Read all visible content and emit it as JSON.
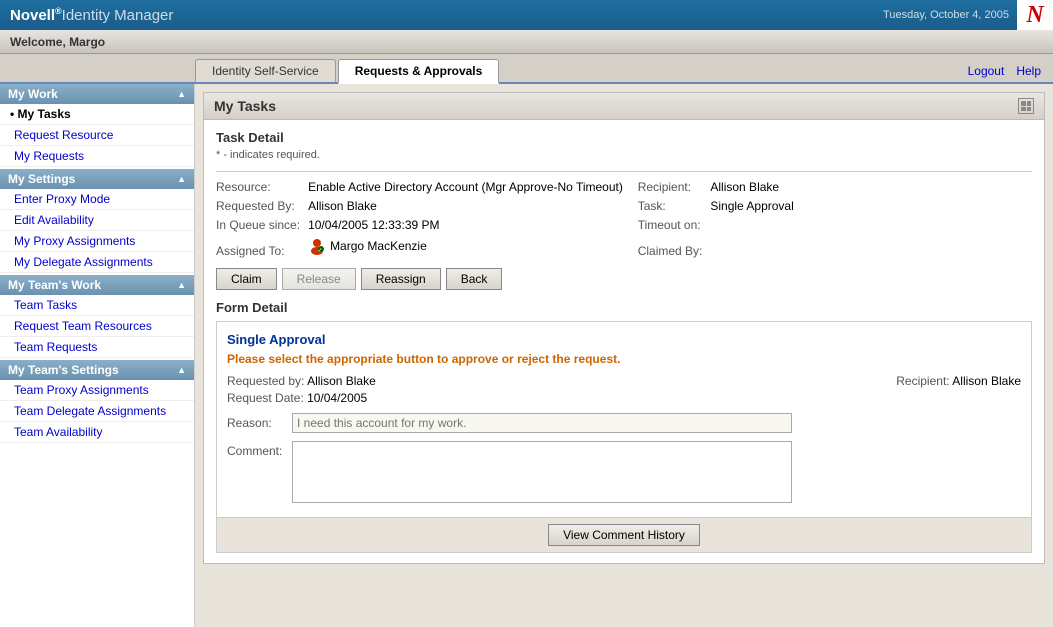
{
  "header": {
    "logo": "Novell",
    "reg_mark": "®",
    "subtitle": " Identity Manager",
    "date": "Tuesday, October 4, 2005",
    "novell_letter": "N",
    "welcome": "Welcome, Margo"
  },
  "nav": {
    "tabs": [
      {
        "label": "Identity Self-Service",
        "active": false
      },
      {
        "label": "Requests & Approvals",
        "active": true
      }
    ],
    "links": [
      {
        "label": "Logout"
      },
      {
        "label": "Help"
      }
    ]
  },
  "sidebar": {
    "sections": [
      {
        "title": "My Work",
        "items": [
          {
            "label": "My Tasks",
            "active": true
          },
          {
            "label": "Request Resource",
            "active": false
          },
          {
            "label": "My Requests",
            "active": false
          }
        ]
      },
      {
        "title": "My Settings",
        "items": [
          {
            "label": "Enter Proxy Mode",
            "active": false
          },
          {
            "label": "Edit Availability",
            "active": false
          },
          {
            "label": "My Proxy Assignments",
            "active": false
          },
          {
            "label": "My Delegate Assignments",
            "active": false
          }
        ]
      },
      {
        "title": "My Team's Work",
        "items": [
          {
            "label": "Team Tasks",
            "active": false
          },
          {
            "label": "Request Team Resources",
            "active": false
          },
          {
            "label": "Team Requests",
            "active": false
          }
        ]
      },
      {
        "title": "My Team's Settings",
        "items": [
          {
            "label": "Team Proxy Assignments",
            "active": false
          },
          {
            "label": "Team Delegate Assignments",
            "active": false
          },
          {
            "label": "Team Availability",
            "active": false
          }
        ]
      }
    ]
  },
  "main": {
    "panel_title": "My Tasks",
    "task_detail": {
      "title": "Task Detail",
      "required_note": "* - indicates required.",
      "fields": {
        "resource_label": "Resource:",
        "resource_value": "Enable Active Directory Account (Mgr Approve-No Timeout)",
        "recipient_label": "Recipient:",
        "recipient_value": "Allison Blake",
        "requested_by_label": "Requested By:",
        "requested_by_value": "Allison Blake",
        "task_label": "Task:",
        "task_value": "Single Approval",
        "in_queue_label": "In Queue since:",
        "in_queue_value": "10/04/2005 12:33:39 PM",
        "timeout_label": "Timeout on:",
        "timeout_value": "",
        "assigned_to_label": "Assigned To:",
        "assigned_to_value": "Margo MacKenzie",
        "claimed_by_label": "Claimed By:",
        "claimed_by_value": ""
      },
      "buttons": {
        "claim": "Claim",
        "release": "Release",
        "reassign": "Reassign",
        "back": "Back"
      }
    },
    "form_detail": {
      "title": "Form Detail",
      "form_title": "Single Approval",
      "instruction": "Please select the appropriate button to approve or reject the request.",
      "requested_by_label": "Requested by:",
      "requested_by_value": "Allison Blake",
      "recipient_label": "Recipient:",
      "recipient_value": "Allison Blake",
      "request_date_label": "Request Date:",
      "request_date_value": "10/04/2005",
      "reason_label": "Reason:",
      "reason_placeholder": "I need this account for my work.",
      "comment_label": "Comment:",
      "comment_value": "",
      "view_comment_btn": "View Comment History"
    }
  }
}
